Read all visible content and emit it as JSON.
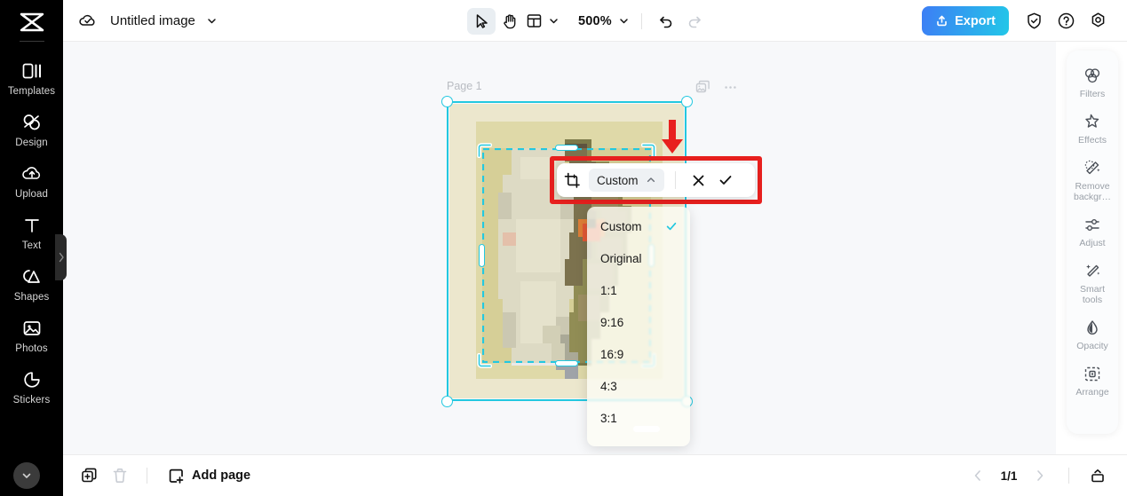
{
  "app": {
    "logo": "capcut-logo",
    "doc_title": "Untitled image"
  },
  "sidebar": {
    "items": [
      {
        "icon": "templates-icon",
        "label": "Templates"
      },
      {
        "icon": "design-icon",
        "label": "Design"
      },
      {
        "icon": "upload-icon",
        "label": "Upload"
      },
      {
        "icon": "text-icon",
        "label": "Text"
      },
      {
        "icon": "shapes-icon",
        "label": "Shapes"
      },
      {
        "icon": "photos-icon",
        "label": "Photos"
      },
      {
        "icon": "stickers-icon",
        "label": "Stickers"
      }
    ],
    "collapse_icon": "chevron-down-icon",
    "panel_handle_icon": "chevron-right-icon"
  },
  "topbar": {
    "cloud_icon": "cloud-saved-icon",
    "title_caret_icon": "chevron-down-icon",
    "tools": {
      "select_icon": "cursor-select-icon",
      "hand_icon": "hand-pan-icon",
      "layout_icon": "layout-grid-icon",
      "layout_caret_icon": "chevron-down-icon",
      "zoom_value": "500%",
      "zoom_caret_icon": "chevron-down-icon",
      "undo_icon": "undo-icon",
      "redo_icon": "redo-icon"
    },
    "export_label": "Export",
    "export_icon": "upload-share-icon",
    "export_gradient_from": "#3d7ef5",
    "export_gradient_to": "#22c7e8",
    "shield_icon": "shield-check-icon",
    "help_icon": "question-circle-icon",
    "settings_icon": "gear-icon"
  },
  "canvas": {
    "page_label": "Page 1",
    "duplicate_page_icon": "duplicate-image-icon",
    "more_icon": "more-horizontal-icon",
    "selection_color": "#23c8e0",
    "artboard_bg": "#ece7cd",
    "crop_overlay_color": "#dfd9a8",
    "annotation_arrow_color": "#e8201e",
    "annotation_box_color": "#e8201e"
  },
  "crop_toolbar": {
    "crop_icon": "crop-icon",
    "ratio_label": "Custom",
    "ratio_caret_icon": "chevron-up-icon",
    "cancel_icon": "close-x-icon",
    "confirm_icon": "check-icon"
  },
  "ratio_menu": {
    "check_color": "#23c8e0",
    "items": [
      {
        "label": "Custom",
        "selected": true
      },
      {
        "label": "Original",
        "selected": false
      },
      {
        "label": "1:1",
        "selected": false
      },
      {
        "label": "9:16",
        "selected": false
      },
      {
        "label": "16:9",
        "selected": false
      },
      {
        "label": "4:3",
        "selected": false
      },
      {
        "label": "3:1",
        "selected": false
      }
    ]
  },
  "right_panel": {
    "items": [
      {
        "icon": "filters-icon",
        "label": "Filters"
      },
      {
        "icon": "effects-icon",
        "label": "Effects"
      },
      {
        "icon": "magic-wand-icon",
        "label": "Remove\nbackgr…"
      },
      {
        "icon": "sliders-icon",
        "label": "Adjust"
      },
      {
        "icon": "sparkle-wand-icon",
        "label": "Smart\ntools"
      },
      {
        "icon": "droplet-icon",
        "label": "Opacity"
      },
      {
        "icon": "arrange-icon",
        "label": "Arrange"
      }
    ]
  },
  "bottombar": {
    "duplicate_icon": "duplicate-page-icon",
    "delete_icon": "trash-icon",
    "add_page_icon": "add-page-icon",
    "add_page_label": "Add page",
    "prev_icon": "chevron-left-icon",
    "page_count": "1/1",
    "next_icon": "chevron-right-icon",
    "toggle_panel_icon": "collapse-panel-icon"
  }
}
